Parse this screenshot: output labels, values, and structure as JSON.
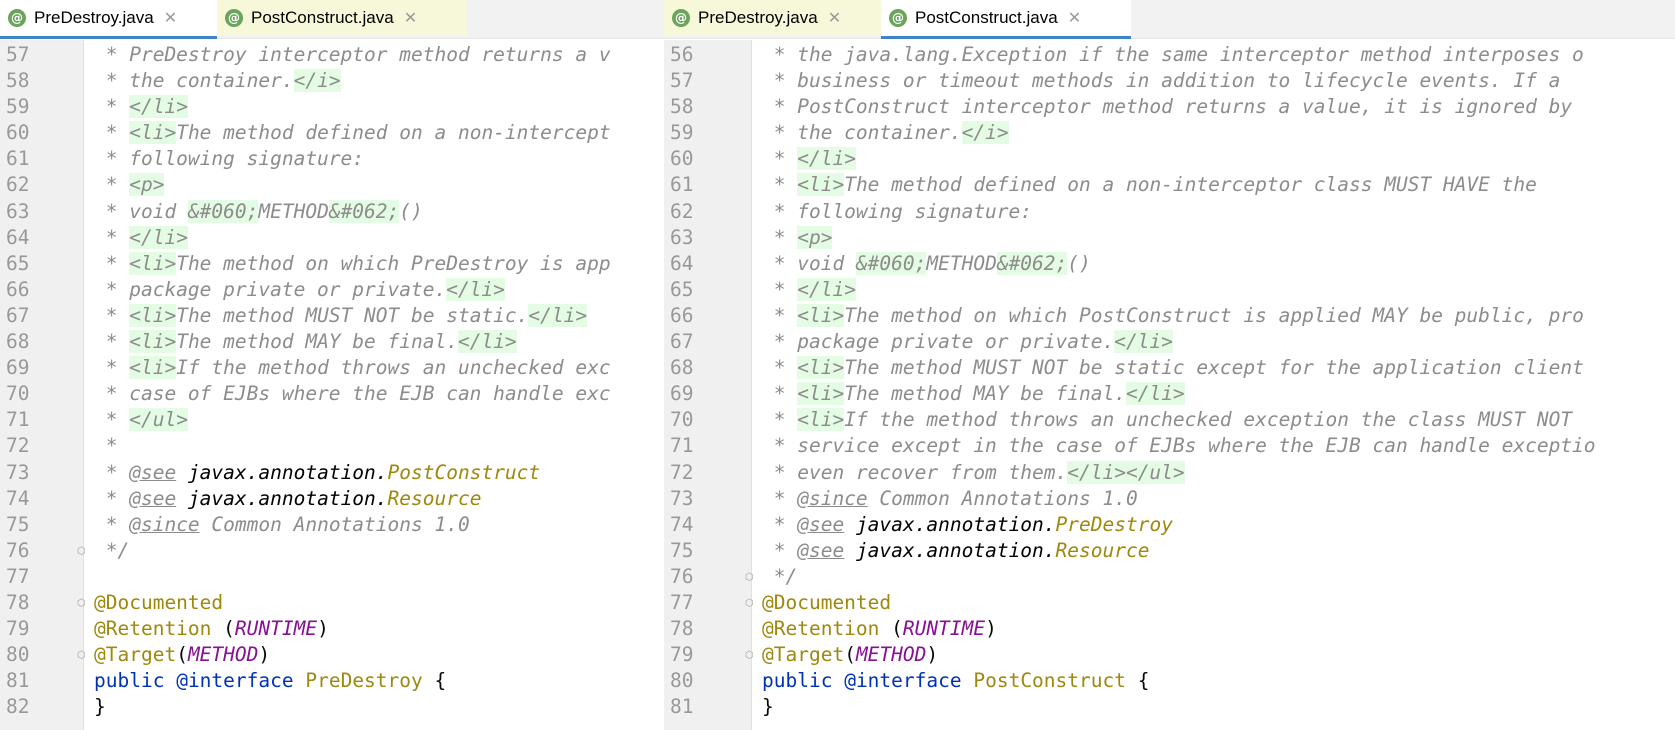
{
  "left": {
    "tabs": [
      {
        "label": "PreDestroy.java",
        "active": true
      },
      {
        "label": "PostConstruct.java",
        "active": false
      }
    ],
    "lines": [
      {
        "n": "57",
        "s": [
          [
            "c",
            " * PreDestroy interceptor method returns a v"
          ]
        ]
      },
      {
        "n": "58",
        "s": [
          [
            "c",
            " * the container."
          ],
          [
            "tag",
            "</i>"
          ]
        ]
      },
      {
        "n": "59",
        "s": [
          [
            "c",
            " * "
          ],
          [
            "tag",
            "</li>"
          ]
        ]
      },
      {
        "n": "60",
        "s": [
          [
            "c",
            " * "
          ],
          [
            "tag",
            "<li>"
          ],
          [
            "c",
            "The method defined on a non-intercept"
          ]
        ]
      },
      {
        "n": "61",
        "s": [
          [
            "c",
            " * following signature:"
          ]
        ]
      },
      {
        "n": "62",
        "s": [
          [
            "c",
            " * "
          ],
          [
            "tag",
            "<p>"
          ]
        ]
      },
      {
        "n": "63",
        "s": [
          [
            "c",
            " * void "
          ],
          [
            "tag",
            "&#060;"
          ],
          [
            "c",
            "METHOD"
          ],
          [
            "tag",
            "&#062;"
          ],
          [
            "c",
            "()"
          ]
        ]
      },
      {
        "n": "64",
        "s": [
          [
            "c",
            " * "
          ],
          [
            "tag",
            "</li>"
          ]
        ]
      },
      {
        "n": "65",
        "s": [
          [
            "c",
            " * "
          ],
          [
            "tag",
            "<li>"
          ],
          [
            "c",
            "The method on which PreDestroy is app"
          ]
        ]
      },
      {
        "n": "66",
        "s": [
          [
            "c",
            " * package private or private."
          ],
          [
            "tag",
            "</li>"
          ]
        ]
      },
      {
        "n": "67",
        "s": [
          [
            "c",
            " * "
          ],
          [
            "tag",
            "<li>"
          ],
          [
            "c",
            "The method MUST NOT be static."
          ],
          [
            "tag",
            "</li>"
          ]
        ]
      },
      {
        "n": "68",
        "s": [
          [
            "c",
            " * "
          ],
          [
            "tag",
            "<li>"
          ],
          [
            "c",
            "The method MAY be final."
          ],
          [
            "tag",
            "</li>"
          ]
        ]
      },
      {
        "n": "69",
        "s": [
          [
            "c",
            " * "
          ],
          [
            "tag",
            "<li>"
          ],
          [
            "c",
            "If the method throws an unchecked exc"
          ]
        ]
      },
      {
        "n": "70",
        "s": [
          [
            "c",
            " * case of EJBs where the EJB can handle exc"
          ]
        ]
      },
      {
        "n": "71",
        "s": [
          [
            "c",
            " * "
          ],
          [
            "tag",
            "</ul>"
          ]
        ]
      },
      {
        "n": "72",
        "s": [
          [
            "c",
            " *"
          ]
        ]
      },
      {
        "n": "73",
        "s": [
          [
            "c",
            " * "
          ],
          [
            "jd",
            "@see"
          ],
          [
            "ref",
            " javax.annotation."
          ],
          [
            "refc",
            "PostConstruct"
          ]
        ]
      },
      {
        "n": "74",
        "s": [
          [
            "c",
            " * "
          ],
          [
            "jd",
            "@see"
          ],
          [
            "ref",
            " javax.annotation."
          ],
          [
            "refc",
            "Resource"
          ]
        ]
      },
      {
        "n": "75",
        "s": [
          [
            "c",
            " * "
          ],
          [
            "jd",
            "@since"
          ],
          [
            "c",
            " Common Annotations 1.0"
          ]
        ]
      },
      {
        "n": "76",
        "s": [
          [
            "c",
            " */"
          ]
        ],
        "fold": true
      },
      {
        "n": "77",
        "s": []
      },
      {
        "n": "78",
        "s": [
          [
            "ann",
            "@Documented"
          ]
        ],
        "fold": true
      },
      {
        "n": "79",
        "s": [
          [
            "ann",
            "@Retention"
          ],
          [
            "plain",
            " ("
          ],
          [
            "const",
            "RUNTIME"
          ],
          [
            "plain",
            ")"
          ]
        ]
      },
      {
        "n": "80",
        "s": [
          [
            "ann",
            "@Target"
          ],
          [
            "plain",
            "("
          ],
          [
            "const",
            "METHOD"
          ],
          [
            "plain",
            ")"
          ]
        ],
        "fold": true
      },
      {
        "n": "81",
        "s": [
          [
            "kw",
            "public"
          ],
          [
            "plain",
            " "
          ],
          [
            "kw",
            "@interface"
          ],
          [
            "plain",
            " "
          ],
          [
            "cls",
            "PreDestroy"
          ],
          [
            "plain",
            " {"
          ]
        ]
      },
      {
        "n": "82",
        "s": [
          [
            "plain",
            "}"
          ]
        ]
      }
    ]
  },
  "right": {
    "tabs": [
      {
        "label": "PreDestroy.java",
        "active": false
      },
      {
        "label": "PostConstruct.java",
        "active": true
      }
    ],
    "lines": [
      {
        "n": "56",
        "s": [
          [
            "c",
            " * the java.lang.Exception if the same interceptor method interposes o"
          ]
        ]
      },
      {
        "n": "57",
        "s": [
          [
            "c",
            " * business or timeout methods in addition to lifecycle events. If a"
          ]
        ]
      },
      {
        "n": "58",
        "s": [
          [
            "c",
            " * PostConstruct interceptor method returns a value, it is ignored by"
          ]
        ]
      },
      {
        "n": "59",
        "s": [
          [
            "c",
            " * the container."
          ],
          [
            "tag",
            "</i>"
          ]
        ]
      },
      {
        "n": "60",
        "s": [
          [
            "c",
            " * "
          ],
          [
            "tag",
            "</li>"
          ]
        ]
      },
      {
        "n": "61",
        "s": [
          [
            "c",
            " * "
          ],
          [
            "tag",
            "<li>"
          ],
          [
            "c",
            "The method defined on a non-interceptor class MUST HAVE the"
          ]
        ]
      },
      {
        "n": "62",
        "s": [
          [
            "c",
            " * following signature:"
          ]
        ]
      },
      {
        "n": "63",
        "s": [
          [
            "c",
            " * "
          ],
          [
            "tag",
            "<p>"
          ]
        ]
      },
      {
        "n": "64",
        "s": [
          [
            "c",
            " * void "
          ],
          [
            "tag",
            "&#060;"
          ],
          [
            "c",
            "METHOD"
          ],
          [
            "tag",
            "&#062;"
          ],
          [
            "c",
            "()"
          ]
        ]
      },
      {
        "n": "65",
        "s": [
          [
            "c",
            " * "
          ],
          [
            "tag",
            "</li>"
          ]
        ]
      },
      {
        "n": "66",
        "s": [
          [
            "c",
            " * "
          ],
          [
            "tag",
            "<li>"
          ],
          [
            "c",
            "The method on which PostConstruct is applied MAY be public, pro"
          ]
        ]
      },
      {
        "n": "67",
        "s": [
          [
            "c",
            " * package private or private."
          ],
          [
            "tag",
            "</li>"
          ]
        ]
      },
      {
        "n": "68",
        "s": [
          [
            "c",
            " * "
          ],
          [
            "tag",
            "<li>"
          ],
          [
            "c",
            "The method MUST NOT be static except for the application client"
          ]
        ]
      },
      {
        "n": "69",
        "s": [
          [
            "c",
            " * "
          ],
          [
            "tag",
            "<li>"
          ],
          [
            "c",
            "The method MAY be final."
          ],
          [
            "tag",
            "</li>"
          ]
        ]
      },
      {
        "n": "70",
        "s": [
          [
            "c",
            " * "
          ],
          [
            "tag",
            "<li>"
          ],
          [
            "c",
            "If the method throws an unchecked exception the class MUST NOT "
          ]
        ]
      },
      {
        "n": "71",
        "s": [
          [
            "c",
            " * service except in the case of EJBs where the EJB can handle exceptio"
          ]
        ]
      },
      {
        "n": "72",
        "s": [
          [
            "c",
            " * even recover from them."
          ],
          [
            "tag",
            "</li></ul>"
          ]
        ]
      },
      {
        "n": "73",
        "s": [
          [
            "c",
            " * "
          ],
          [
            "jd",
            "@since"
          ],
          [
            "c",
            " Common Annotations 1.0"
          ]
        ]
      },
      {
        "n": "74",
        "s": [
          [
            "c",
            " * "
          ],
          [
            "jd",
            "@see"
          ],
          [
            "ref",
            " javax.annotation."
          ],
          [
            "refc",
            "PreDestroy"
          ]
        ]
      },
      {
        "n": "75",
        "s": [
          [
            "c",
            " * "
          ],
          [
            "jd",
            "@see"
          ],
          [
            "ref",
            " javax.annotation."
          ],
          [
            "refc",
            "Resource"
          ]
        ]
      },
      {
        "n": "76",
        "s": [
          [
            "c",
            " */"
          ]
        ],
        "fold": true
      },
      {
        "n": "77",
        "s": [
          [
            "ann",
            "@Documented"
          ]
        ],
        "fold": true
      },
      {
        "n": "78",
        "s": [
          [
            "ann",
            "@Retention"
          ],
          [
            "plain",
            " ("
          ],
          [
            "const",
            "RUNTIME"
          ],
          [
            "plain",
            ")"
          ]
        ]
      },
      {
        "n": "79",
        "s": [
          [
            "ann",
            "@Target"
          ],
          [
            "plain",
            "("
          ],
          [
            "const",
            "METHOD"
          ],
          [
            "plain",
            ")"
          ]
        ],
        "fold": true
      },
      {
        "n": "80",
        "s": [
          [
            "kw",
            "public"
          ],
          [
            "plain",
            " "
          ],
          [
            "kw",
            "@interface"
          ],
          [
            "plain",
            " "
          ],
          [
            "cls",
            "PostConstruct"
          ],
          [
            "plain",
            " {"
          ]
        ]
      },
      {
        "n": "81",
        "s": [
          [
            "plain",
            "}"
          ]
        ]
      }
    ]
  },
  "icons": {
    "tab_badge": "annotation-type-icon",
    "tab_close": "close-icon",
    "fold": "fold-marker-icon"
  },
  "colors": {
    "comment": "#8c8c8c",
    "html_tag_bg": "#e3fce3",
    "keyword": "#0033b3",
    "annotation": "#9e880d",
    "constant": "#871094",
    "active_tab_underline": "#4083c9",
    "inactive_tab_bg": "#f7f7da"
  }
}
